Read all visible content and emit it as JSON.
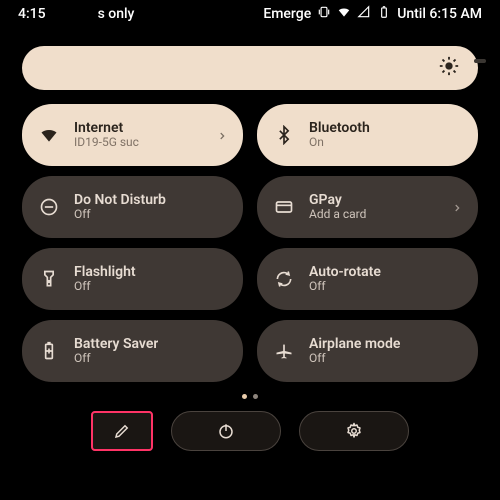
{
  "status": {
    "time": "4:15",
    "left_extra": "s only",
    "right_label": "Emerge",
    "until": "Until 6:15 AM"
  },
  "tiles": {
    "internet": {
      "label": "Internet",
      "sub": "ID19-5G      suc"
    },
    "bluetooth": {
      "label": "Bluetooth",
      "sub": "On"
    },
    "dnd": {
      "label": "Do Not Disturb",
      "sub": "Off"
    },
    "gpay": {
      "label": "GPay",
      "sub": "Add a card"
    },
    "flashlight": {
      "label": "Flashlight",
      "sub": "Off"
    },
    "autorotate": {
      "label": "Auto-rotate",
      "sub": "Off"
    },
    "battery_saver": {
      "label": "Battery Saver",
      "sub": "Off"
    },
    "airplane": {
      "label": "Airplane mode",
      "sub": "Off"
    }
  },
  "colors": {
    "tile_on": "#f0decb",
    "tile_off": "#3f3834"
  }
}
